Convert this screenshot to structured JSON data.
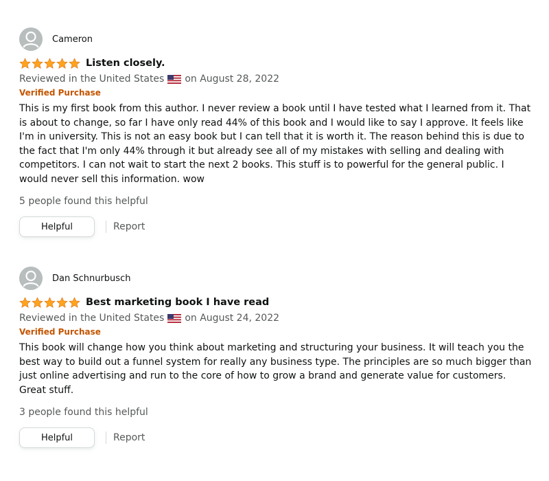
{
  "colors": {
    "star": "#ffa41c",
    "verified": "#c45500",
    "muted": "#565959",
    "text": "#0f1111"
  },
  "reviews": [
    {
      "author": "Cameron",
      "avatar_icon": "user-silhouette-icon",
      "rating": 5,
      "title": "Listen closely.",
      "meta_prefix": "Reviewed in the United States",
      "flag_icon": "us-flag-icon",
      "meta_suffix": "on August 28, 2022",
      "verified": "Verified Purchase",
      "body": "This is my first book from this author. I never review a book until I have tested what I learned from it. That is about to change, so far I have only read 44% of this book and I would like to say I approve. It feels like I'm in university. This is not an easy book but I can tell that it is worth it. The reason behind this is due to the fact that I'm only 44% through it but already see all of my mistakes with selling and dealing with competitors. I can not wait to start the next 2 books. This stuff is to powerful for the general public. I would never sell this information. wow",
      "helpful_count": "5 people found this helpful",
      "helpful_label": "Helpful",
      "report_label": "Report"
    },
    {
      "author": "Dan Schnurbusch",
      "avatar_icon": "user-silhouette-icon",
      "rating": 5,
      "title": "Best marketing book I have read",
      "meta_prefix": "Reviewed in the United States",
      "flag_icon": "us-flag-icon",
      "meta_suffix": "on August 24, 2022",
      "verified": "Verified Purchase",
      "body": "This book will change how you think about marketing and structuring your business. It will teach you the best way to build out a funnel system for really any business type. The principles are so much bigger than just online advertising and run to the core of how to grow a brand and generate value for customers. Great stuff.",
      "helpful_count": "3 people found this helpful",
      "helpful_label": "Helpful",
      "report_label": "Report"
    }
  ]
}
